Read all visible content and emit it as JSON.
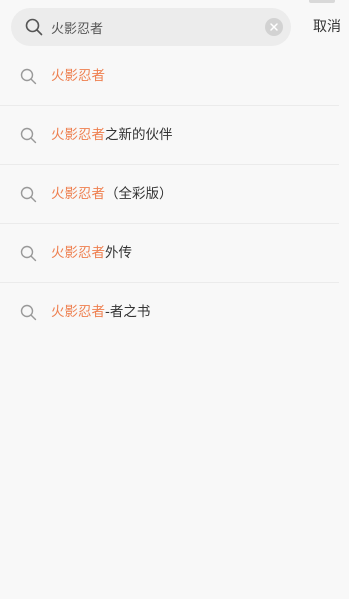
{
  "search": {
    "value": "火影忍者",
    "cancel_label": "取消"
  },
  "colors": {
    "highlight": "#ee7f4f",
    "text": "#333333",
    "background": "#f8f8f8"
  },
  "icons": {
    "search": "search-icon",
    "clear": "clear-icon"
  },
  "suggestions": [
    {
      "match": "火影忍者",
      "rest": ""
    },
    {
      "match": "火影忍者",
      "rest": "之新的伙伴"
    },
    {
      "match": "火影忍者",
      "rest": "（全彩版）"
    },
    {
      "match": "火影忍者",
      "rest": "外传"
    },
    {
      "match": "火影忍者",
      "rest": "-者之书"
    }
  ]
}
